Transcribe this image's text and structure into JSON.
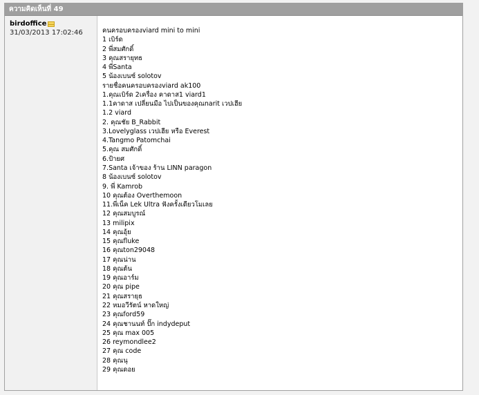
{
  "comment": {
    "header": "ความคิดเห็นที่ 49",
    "author": "birdoffice",
    "date": "31/03/2013 17:02:46",
    "lines": [
      "คนครอบครองviard mini to mini",
      "1 เบิร์ด",
      "2 พี่สมศักดิ์",
      "3 คุณสรายุทธ",
      "4 พี่Santa",
      "5 น้องเบนซ์ solotov",
      "รายชื่อคนครอบครองviard ak100",
      "1.คุณเบิร์ด 2เครื่อง คาดาส1 viard1",
      "1.1คาดาส เปลี่ยนมือ ไปเป็นของคุณnarit เวปเฮีย",
      "1.2 viard",
      "2. คุณชัย B_Rabbit",
      "3.Lovelyglass เวปเฮีย หรือ Everest",
      "4.Tangmo Patomchai",
      "5.คุณ สมศักดิ์",
      "6.ป้ายศ",
      "7.Santa เจ้าของ ร้าน LINN paragon",
      "8 น้องเบนซ์ solotov",
      "9. พี่ Kamrob",
      "10 คุณต้อง Overthemoon",
      "11.พี่เน็ค Lek Ultra ฟังครั้งเดียวโมเลย",
      "12 คุณสมบูรณ์",
      "13 milipix",
      "14 คุณอุ้ย",
      "15 คุณfluke",
      "16 คุณton29048",
      "17 คุณน่าน",
      "18 คุณต้น",
      "19 คุณอาร์ม",
      "20 คุณ pipe",
      "21 คุณสรายุธ",
      "22 หมอวีรัตน์ หาดใหญ่",
      "23 คุณford59",
      "24 คุณชานนท์ ปั๊ก indydeput",
      "25 คุณ max 005",
      "26 reymondlee2",
      "27 คุณ code",
      "28 คุณนุ",
      "29 คุณดอย"
    ]
  },
  "icons": {
    "author_badge": "mail-icon"
  },
  "colors": {
    "header_bg": "#9f9f9f",
    "author_bg": "#f1f1f1"
  }
}
